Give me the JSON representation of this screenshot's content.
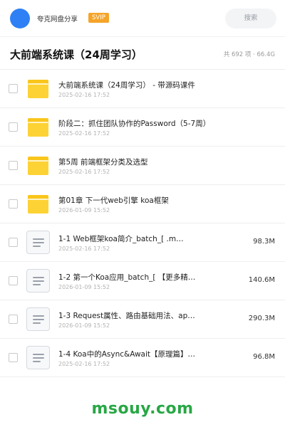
{
  "header": {
    "avatar_color": "#2f80f5",
    "user_name": "夸克网盘分享",
    "badge": "SVIP",
    "search_label": "搜索"
  },
  "folder_title": "大前端系统课（24周学习）",
  "summary": "共 692 项 · 66.4G",
  "items": [
    {
      "kind": "folder",
      "icon": "folder-icon",
      "name": "大前端系统课（24周学习） - 带源码课件",
      "date": "2025-02-16 17:52",
      "size": ""
    },
    {
      "kind": "folder",
      "icon": "folder-icon",
      "name": "阶段二：抓住团队协作的Password（5-7周）",
      "date": "2025-02-16 17:52",
      "size": ""
    },
    {
      "kind": "folder",
      "icon": "folder-icon",
      "name": "第5周 前端框架分类及选型",
      "date": "2025-02-16 17:52",
      "size": ""
    },
    {
      "kind": "folder",
      "icon": "folder-icon",
      "name": "第01章 下一代web引擎 koa框架",
      "date": "2026-01-09 15:52",
      "size": ""
    },
    {
      "kind": "file",
      "icon": "document-icon",
      "name": "1-1 Web框架koa简介_batch_[ .m…",
      "date": "2025-02-16 17:52",
      "size": "98.3M"
    },
    {
      "kind": "file",
      "icon": "document-icon",
      "name": "1-2 第一个Koa应用_batch_[ 【更多精…",
      "date": "2026-01-09 15:52",
      "size": "140.6M"
    },
    {
      "kind": "file",
      "icon": "document-icon",
      "name": "1-3 Request属性、路由基础用法、app.…",
      "date": "2026-01-09 15:52",
      "size": "290.3M"
    },
    {
      "kind": "file",
      "icon": "document-icon",
      "name": "1-4 Koa中的Async&Await【原理篇】…",
      "date": "2025-02-16 17:52",
      "size": "96.8M"
    }
  ],
  "watermark": "msouy.com",
  "colors": {
    "accent": "#2f80f5",
    "badge": "#f5a42a",
    "folder": "#fdd235",
    "watermark": "#28a745"
  }
}
